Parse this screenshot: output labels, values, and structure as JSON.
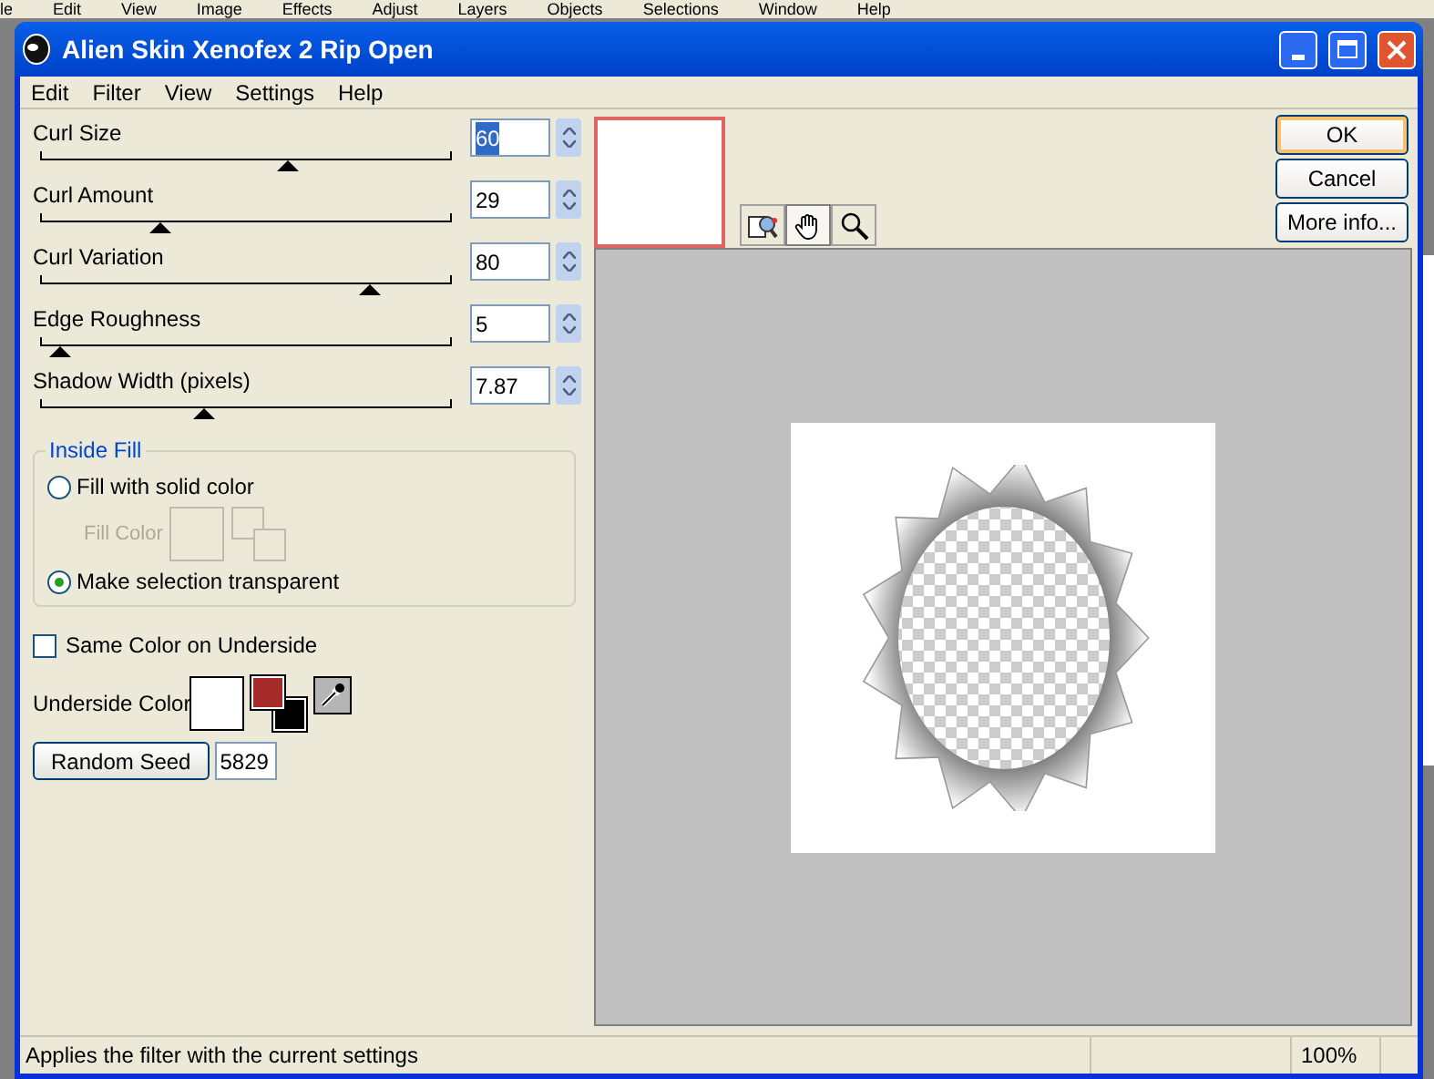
{
  "background_menu": [
    "le",
    "Edit",
    "View",
    "Image",
    "Effects",
    "Adjust",
    "Layers",
    "Objects",
    "Selections",
    "Window",
    "Help"
  ],
  "window": {
    "title": "Alien Skin Xenofex 2 Rip Open"
  },
  "menu": [
    "Edit",
    "Filter",
    "View",
    "Settings",
    "Help"
  ],
  "sliders": [
    {
      "label": "Curl Size",
      "value": "60",
      "level": 0.6,
      "focused": true
    },
    {
      "label": "Curl Amount",
      "value": "29",
      "level": 0.29,
      "focused": false
    },
    {
      "label": "Curl Variation",
      "value": "80",
      "level": 0.8,
      "focused": false
    },
    {
      "label": "Edge Roughness",
      "value": "5",
      "level": 0.05,
      "focused": false
    },
    {
      "label": "Shadow Width (pixels)",
      "value": "7.87",
      "level": 0.4,
      "focused": false
    }
  ],
  "inside_fill": {
    "title": "Inside Fill",
    "options": [
      {
        "label": "Fill with solid color",
        "selected": false
      },
      {
        "label": "Make selection transparent",
        "selected": true
      }
    ],
    "fill_color": {
      "label": "Fill Color",
      "disabled": true
    }
  },
  "same_color": {
    "label": "Same Color on Underside",
    "checked": false
  },
  "underside": {
    "label": "Underside Color",
    "color": "#ffffff",
    "color_pair": [
      {
        "color": "#a52a2a"
      },
      {
        "color": "#000000"
      }
    ]
  },
  "random_seed": {
    "button": "Random Seed",
    "value": "5829"
  },
  "tools": [
    {
      "kind": "compare",
      "selected": false
    },
    {
      "kind": "hand",
      "selected": true
    },
    {
      "kind": "zoom",
      "selected": false
    }
  ],
  "buttons": [
    {
      "label": "OK",
      "default": true
    },
    {
      "label": "Cancel",
      "default": false
    },
    {
      "label": "More info...",
      "default": false
    }
  ],
  "status_bar": {
    "message": "Applies the filter with the current settings",
    "zoom": "100%"
  }
}
